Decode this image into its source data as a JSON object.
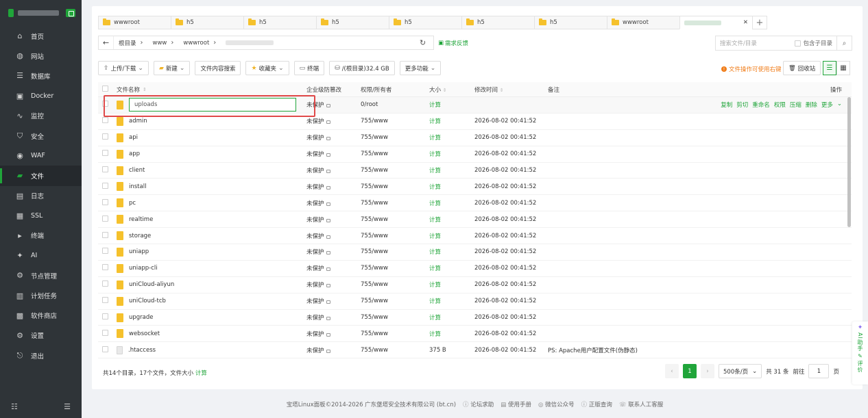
{
  "sidebar": {
    "items": [
      {
        "label": "首页",
        "icon": "home-icon",
        "glyph": "⌂"
      },
      {
        "label": "网站",
        "icon": "globe-icon",
        "glyph": "◍"
      },
      {
        "label": "数据库",
        "icon": "database-icon",
        "glyph": "☰"
      },
      {
        "label": "Docker",
        "icon": "docker-icon",
        "glyph": "▣"
      },
      {
        "label": "监控",
        "icon": "monitor-icon",
        "glyph": "∿"
      },
      {
        "label": "安全",
        "icon": "shield-icon",
        "glyph": "⛉"
      },
      {
        "label": "WAF",
        "icon": "waf-icon",
        "glyph": "◉"
      },
      {
        "label": "文件",
        "icon": "folder-icon",
        "glyph": "▰"
      },
      {
        "label": "日志",
        "icon": "log-icon",
        "glyph": "▤"
      },
      {
        "label": "SSL",
        "icon": "ssl-icon",
        "glyph": "▦"
      },
      {
        "label": "终端",
        "icon": "terminal-icon",
        "glyph": "▸"
      },
      {
        "label": "AI",
        "icon": "ai-icon",
        "glyph": "✦"
      },
      {
        "label": "节点管理",
        "icon": "nodes-icon",
        "glyph": "⚙"
      },
      {
        "label": "计划任务",
        "icon": "calendar-icon",
        "glyph": "▥"
      },
      {
        "label": "软件商店",
        "icon": "store-icon",
        "glyph": "▩"
      },
      {
        "label": "设置",
        "icon": "gear-icon",
        "glyph": "⚙"
      },
      {
        "label": "退出",
        "icon": "logout-icon",
        "glyph": "⎋"
      }
    ],
    "active_index": 7
  },
  "tabs": [
    {
      "label": "wwwroot"
    },
    {
      "label": "h5"
    },
    {
      "label": "h5"
    },
    {
      "label": "h5"
    },
    {
      "label": "h5"
    },
    {
      "label": "h5"
    },
    {
      "label": "h5"
    },
    {
      "label": "wwwroot"
    }
  ],
  "path": {
    "crumbs": [
      "根目录",
      "www",
      "wwwroot"
    ],
    "feedback": "需求反馈"
  },
  "search": {
    "placeholder": "搜索文件/目录",
    "include_sub": "包含子目录"
  },
  "toolbar": {
    "upload": "上传/下载",
    "new": "新建",
    "content_search": "文件内容搜索",
    "favorites": "收藏夹",
    "terminal": "终端",
    "disk": "/(根目录)32.4 GB",
    "more": "更多功能",
    "warn_link": "文件操作可使用右键",
    "recycle": "回收站"
  },
  "table": {
    "headers": {
      "name": "文件名称",
      "protect": "企业级防篡改",
      "perm": "权限/所有者",
      "size": "大小",
      "mtime": "修改时间",
      "note": "备注",
      "ops": "操作"
    },
    "rename_value": "uploads",
    "first_row": {
      "protect": "未保护",
      "perm": "0/root",
      "size": "计算",
      "ops": [
        "复制",
        "剪切",
        "重命名",
        "权限",
        "压缩",
        "删除",
        "更多"
      ]
    },
    "rows": [
      {
        "name": "admin",
        "type": "folder",
        "protect": "未保护",
        "perm": "755/www",
        "size": "计算",
        "mtime": "2026-08-02 00:41:52",
        "note": ""
      },
      {
        "name": "api",
        "type": "folder",
        "protect": "未保护",
        "perm": "755/www",
        "size": "计算",
        "mtime": "2026-08-02 00:41:52",
        "note": ""
      },
      {
        "name": "app",
        "type": "folder",
        "protect": "未保护",
        "perm": "755/www",
        "size": "计算",
        "mtime": "2026-08-02 00:41:52",
        "note": ""
      },
      {
        "name": "client",
        "type": "folder",
        "protect": "未保护",
        "perm": "755/www",
        "size": "计算",
        "mtime": "2026-08-02 00:41:52",
        "note": ""
      },
      {
        "name": "install",
        "type": "folder",
        "protect": "未保护",
        "perm": "755/www",
        "size": "计算",
        "mtime": "2026-08-02 00:41:52",
        "note": ""
      },
      {
        "name": "pc",
        "type": "folder",
        "protect": "未保护",
        "perm": "755/www",
        "size": "计算",
        "mtime": "2026-08-02 00:41:52",
        "note": ""
      },
      {
        "name": "realtime",
        "type": "folder",
        "protect": "未保护",
        "perm": "755/www",
        "size": "计算",
        "mtime": "2026-08-02 00:41:52",
        "note": ""
      },
      {
        "name": "storage",
        "type": "folder",
        "protect": "未保护",
        "perm": "755/www",
        "size": "计算",
        "mtime": "2026-08-02 00:41:52",
        "note": ""
      },
      {
        "name": "uniapp",
        "type": "folder",
        "protect": "未保护",
        "perm": "755/www",
        "size": "计算",
        "mtime": "2026-08-02 00:41:52",
        "note": ""
      },
      {
        "name": "uniapp-cli",
        "type": "folder",
        "protect": "未保护",
        "perm": "755/www",
        "size": "计算",
        "mtime": "2026-08-02 00:41:52",
        "note": ""
      },
      {
        "name": "uniCloud-aliyun",
        "type": "folder",
        "protect": "未保护",
        "perm": "755/www",
        "size": "计算",
        "mtime": "2026-08-02 00:41:52",
        "note": ""
      },
      {
        "name": "uniCloud-tcb",
        "type": "folder",
        "protect": "未保护",
        "perm": "755/www",
        "size": "计算",
        "mtime": "2026-08-02 00:41:52",
        "note": ""
      },
      {
        "name": "upgrade",
        "type": "folder",
        "protect": "未保护",
        "perm": "755/www",
        "size": "计算",
        "mtime": "2026-08-02 00:41:52",
        "note": ""
      },
      {
        "name": "websocket",
        "type": "folder",
        "protect": "未保护",
        "perm": "755/www",
        "size": "计算",
        "mtime": "2026-08-02 00:41:52",
        "note": ""
      },
      {
        "name": ".htaccess",
        "type": "file",
        "protect": "未保护",
        "perm": "755/www",
        "size": "375 B",
        "mtime": "2026-08-02 00:41:52",
        "note": "PS: Apache用户配置文件(伪静态)"
      }
    ]
  },
  "summary": {
    "text": "共14个目录，17个文件，文件大小",
    "calc": "计算"
  },
  "pager": {
    "current": "1",
    "page_size": "500条/页",
    "total": "共 31 条",
    "goto": "前往",
    "goto_value": "1",
    "page_unit": "页"
  },
  "footer": {
    "copyright": "宝塔Linux面板©2014-2026 广东堡塔安全技术有限公司 (bt.cn)",
    "links": [
      "论坛求助",
      "使用手册",
      "微信公众号",
      "正版查询",
      "联系人工客服"
    ]
  },
  "ai_helper": {
    "label": "AI助手",
    "rate": "评价"
  },
  "colors": {
    "brand": "#20a53a",
    "sidebar_bg": "#2f3438",
    "warn": "#f07d1a",
    "highlight": "#e04848"
  }
}
